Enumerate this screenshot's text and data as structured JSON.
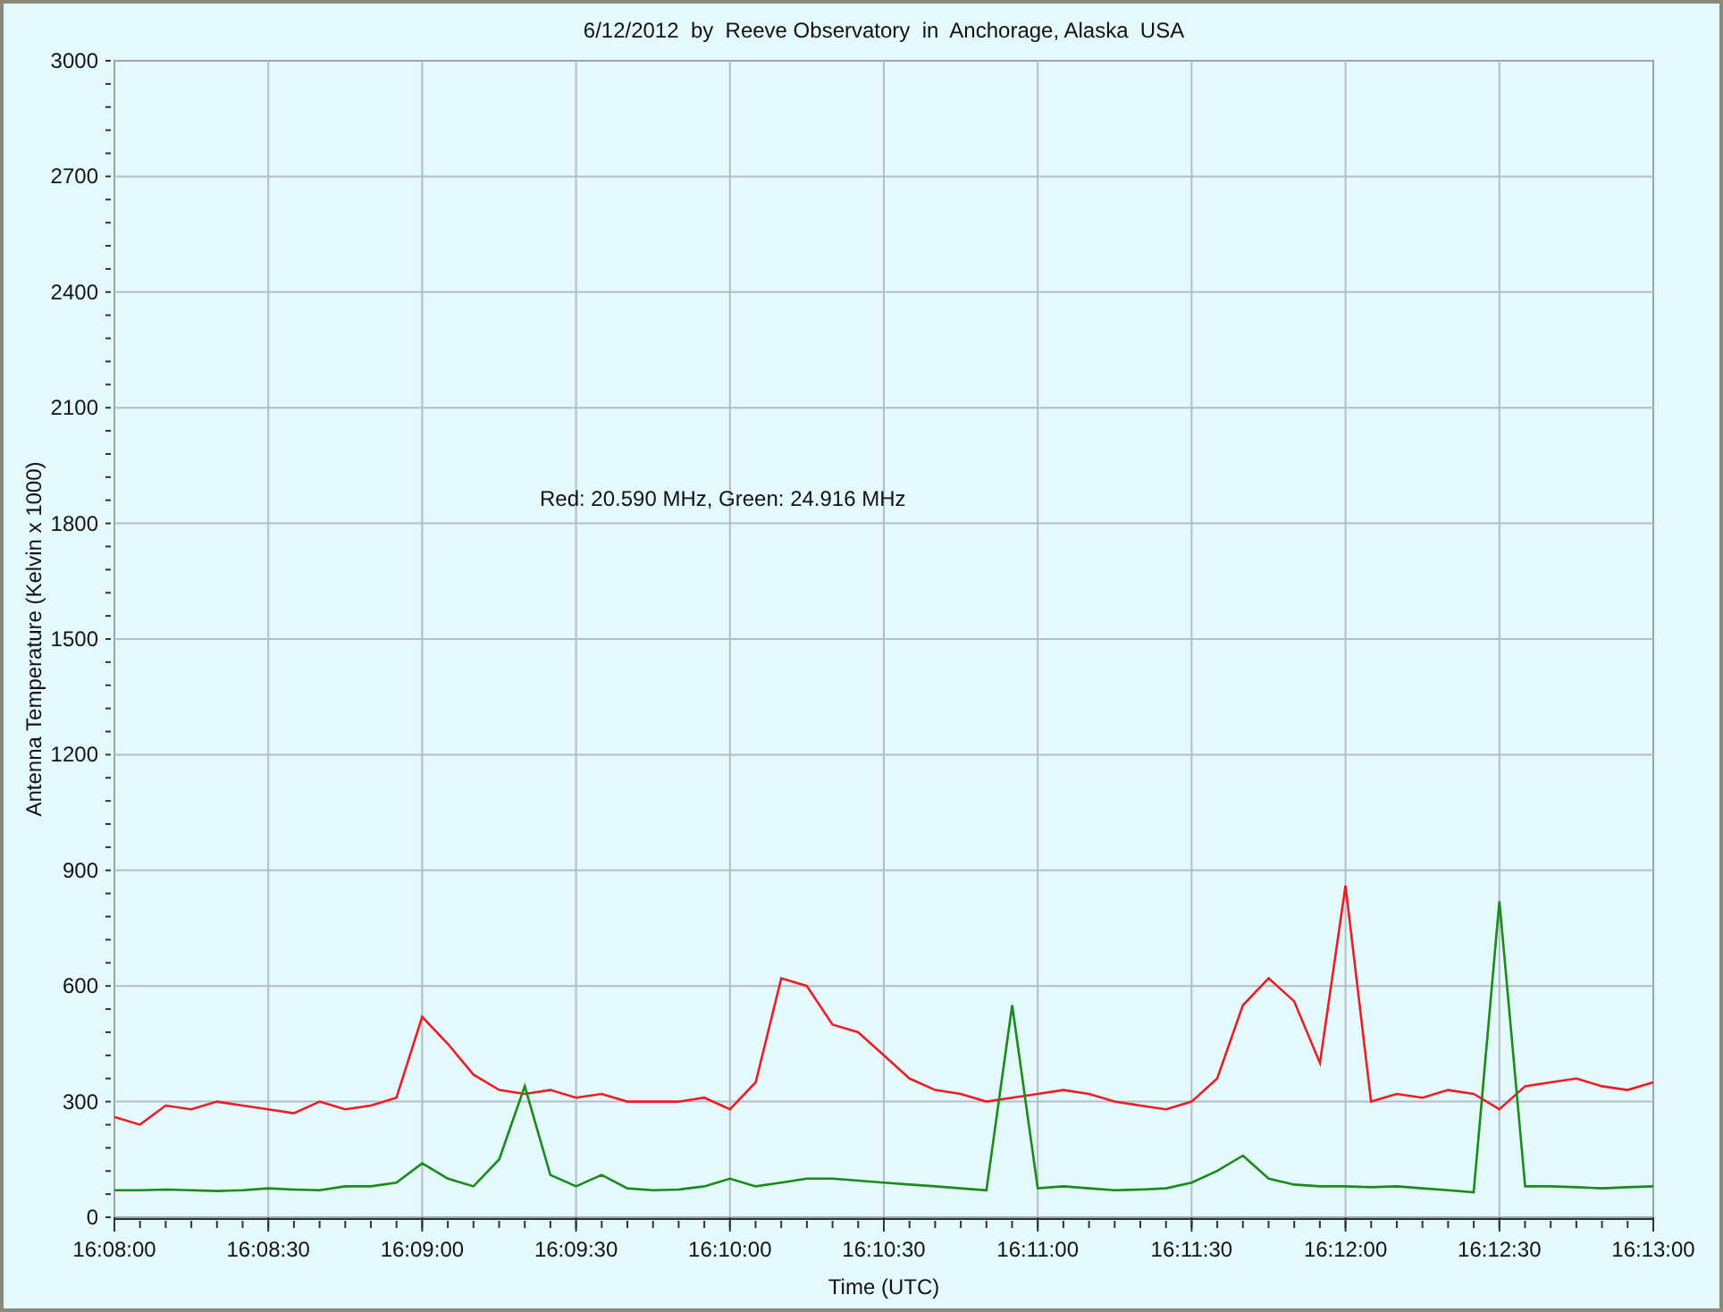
{
  "chart": {
    "chart_data": {
      "type": "line",
      "title": "6/12/2012  by  Reeve Observatory  in  Anchorage, Alaska  USA",
      "xlabel": "Time (UTC)",
      "ylabel": "Antenna Temperature (Kelvin x 1000)",
      "categories": [
        "16:08:00",
        null,
        null,
        null,
        null,
        null,
        "16:08:30",
        null,
        null,
        null,
        null,
        null,
        "16:09:00",
        null,
        null,
        null,
        null,
        null,
        "16:09:30",
        null,
        null,
        null,
        null,
        null,
        "16:10:00",
        null,
        null,
        null,
        null,
        null,
        "16:10:30",
        null,
        null,
        null,
        null,
        null,
        "16:11:00",
        null,
        null,
        null,
        null,
        null,
        "16:11:30",
        null,
        null,
        null,
        null,
        null,
        "16:12:00",
        null,
        null,
        null,
        null,
        null,
        "16:12:30",
        null,
        null,
        null,
        null,
        null,
        "16:13:00"
      ],
      "series": [
        {
          "color": "#ee1c25",
          "values": [
            260,
            240,
            290,
            280,
            300,
            290,
            280,
            270,
            300,
            280,
            290,
            310,
            520,
            450,
            370,
            330,
            320,
            330,
            310,
            320,
            300,
            300,
            300,
            310,
            280,
            350,
            620,
            600,
            500,
            480,
            420,
            360,
            330,
            320,
            300,
            310,
            320,
            330,
            320,
            300,
            290,
            280,
            300,
            360,
            550,
            620,
            560,
            400,
            860,
            300,
            320,
            310,
            330,
            320,
            280,
            340,
            350,
            360,
            340,
            330,
            350
          ]
        },
        {
          "color": "#1a8a1a",
          "values": [
            70,
            70,
            72,
            70,
            68,
            70,
            75,
            72,
            70,
            80,
            80,
            90,
            140,
            100,
            80,
            150,
            340,
            110,
            80,
            110,
            75,
            70,
            72,
            80,
            100,
            80,
            90,
            100,
            100,
            95,
            90,
            85,
            80,
            75,
            70,
            550,
            75,
            80,
            75,
            70,
            72,
            75,
            90,
            120,
            160,
            100,
            85,
            80,
            80,
            78,
            80,
            75,
            70,
            65,
            820,
            80,
            80,
            78,
            75,
            78,
            80
          ]
        }
      ],
      "ylim": [
        0,
        3000
      ],
      "grid": true,
      "yticks": [
        0,
        300,
        600,
        900,
        1200,
        1500,
        1800,
        2100,
        2400,
        2700,
        3000
      ],
      "annotations": [
        "Red: 20.590 MHz, Green: 24.916 MHz"
      ]
    }
  }
}
